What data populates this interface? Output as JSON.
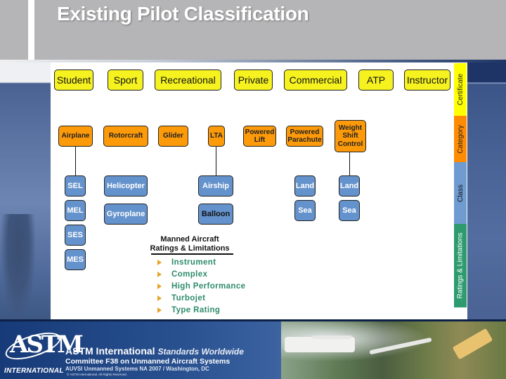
{
  "slide": {
    "title": "Existing Pilot Classification"
  },
  "diagram": {
    "certificates": [
      "Student",
      "Sport",
      "Recreational",
      "Private",
      "Commercial",
      "ATP",
      "Instructor"
    ],
    "categories": [
      "Airplane",
      "Rotorcraft",
      "Glider",
      "LTA",
      "Powered Lift",
      "Powered Parachute",
      "Weight Shift Control"
    ],
    "classes": {
      "airplane": [
        "SEL",
        "MEL",
        "SES",
        "MES"
      ],
      "rotorcraft": [
        "Helicopter",
        "Gyroplane"
      ],
      "lta": [
        "Airship",
        "Balloon"
      ],
      "powered_parachute": [
        "Land",
        "Sea"
      ],
      "weight_shift_control": [
        "Land",
        "Sea"
      ]
    },
    "side_tabs": [
      {
        "label": "Certificate",
        "color": "#ffff00"
      },
      {
        "label": "Category",
        "color": "#ff8c00"
      },
      {
        "label": "Class",
        "color": "#6f9bd1"
      },
      {
        "label": "Ratings & Limitations",
        "color": "#2e9b6f"
      }
    ],
    "ratings": {
      "heading_line1": "Manned Aircraft",
      "heading_line2": "Ratings & Limitations",
      "items": [
        "Instrument",
        "Complex",
        "High Performance",
        "Turbojet",
        "Type Rating"
      ]
    },
    "colors": {
      "certificate": "#f5f21f",
      "category": "#fd9a0a",
      "class": "#6492cc",
      "ratings_text": "#2e8b6a",
      "bullet": "#e4a427"
    }
  },
  "footer": {
    "logo_text": "ASTM",
    "logo_subtext": "INTERNATIONAL",
    "org_name": "ASTM International",
    "tagline": "Standards Worldwide",
    "committee": "Committee F38 on Unmanned Aircraft Systems",
    "event": "AUVSI Unmanned Systems NA 2007 / Washington, DC",
    "copyright": "© ASTM International. All Rights Reserved."
  }
}
